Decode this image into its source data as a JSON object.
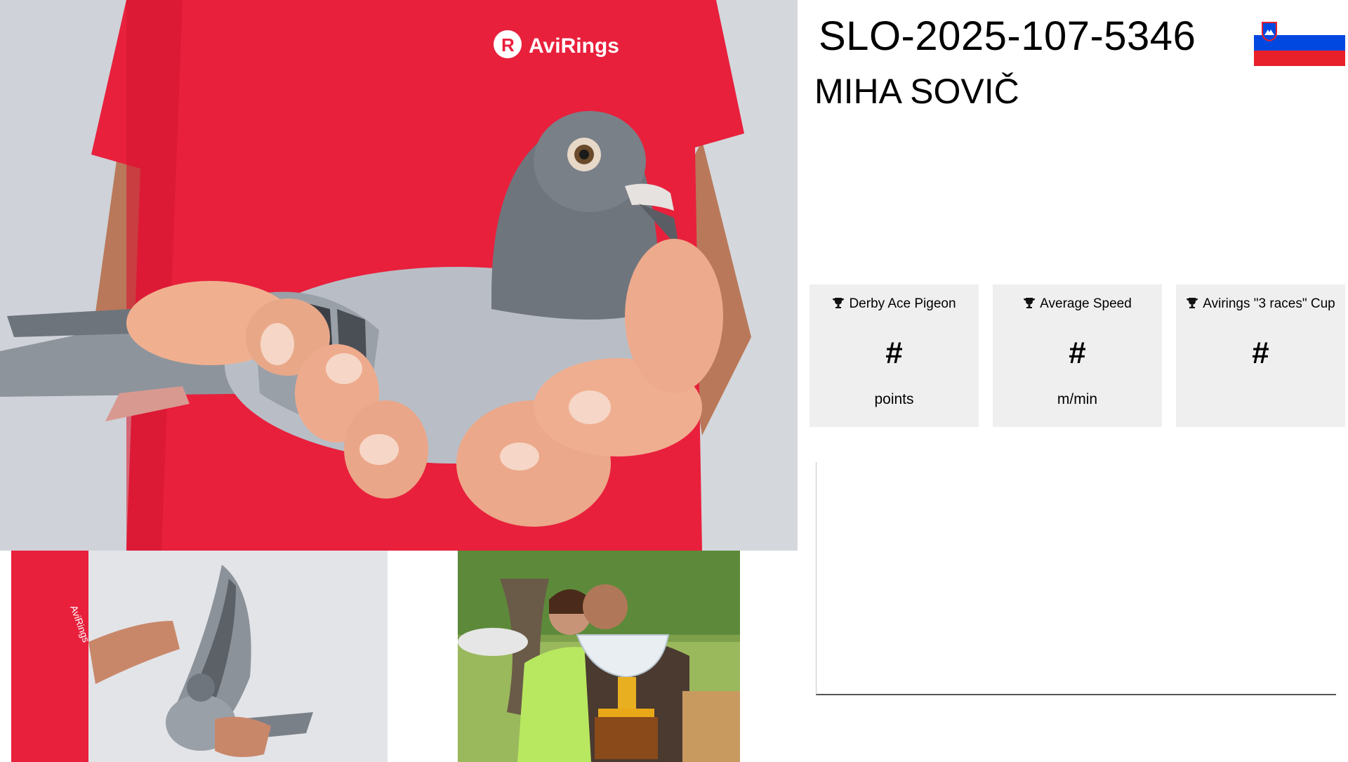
{
  "header": {
    "ring_number": "SLO-2025-107-5346",
    "owner_name": "MIHA SOVIČ",
    "country_flag": {
      "icon": "slovenia-flag-icon",
      "colors": [
        "#ffffff",
        "#0048e0",
        "#e8202a"
      ]
    }
  },
  "photos": {
    "main_logo_text": "AviRings",
    "wing_logo_text": "AviRings",
    "shirt_color": "#e8203c"
  },
  "stats": [
    {
      "icon": "trophy-icon",
      "title": "Derby Ace Pigeon",
      "value": "#",
      "unit": "points"
    },
    {
      "icon": "trophy-icon",
      "title": "Average Speed",
      "value": "#",
      "unit": "m/min"
    },
    {
      "icon": "trophy-icon",
      "title": "Avirings \"3 races\" Cup",
      "value": "#",
      "unit": ""
    }
  ]
}
